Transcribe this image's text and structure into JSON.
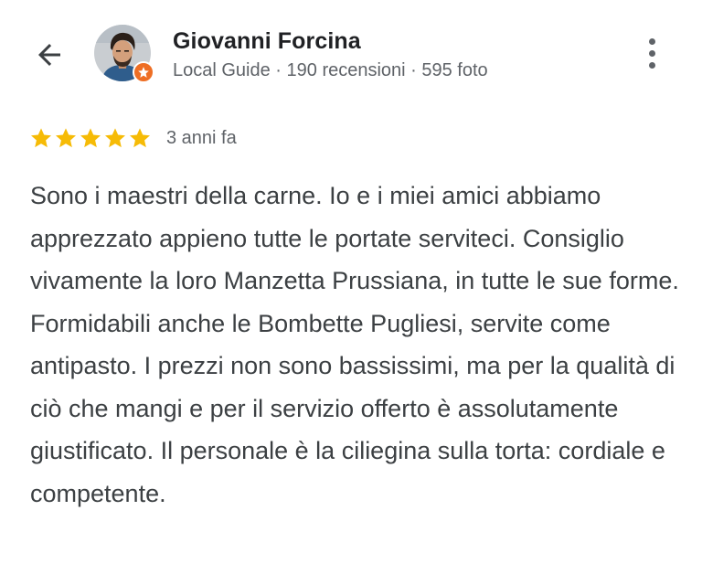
{
  "header": {
    "back_icon": "arrow-back-icon",
    "user_name": "Giovanni Forcina",
    "user_meta": "Local Guide · 190 recensioni · 595 foto",
    "badge_icon": "local-guide-star-icon",
    "menu_icon": "more-vert-icon"
  },
  "review": {
    "rating": 5,
    "rating_max": 5,
    "star_color": "#f6bb06",
    "date": "3 anni fa",
    "text": "Sono i maestri della carne. Io e i miei amici abbiamo apprezzato appieno tutte le portate serviteci. Consiglio vivamente la loro Manzetta Prussiana, in tutte le sue forme. Formidabili anche le Bombette Pugliesi, servite come antipasto. I prezzi non sono bassissimi, ma per la qualità di ciò che mangi e per il servizio offerto è assolutamente giustificato. Il personale è la ciliegina sulla torta: cordiale e competente."
  },
  "colors": {
    "badge": "#ee6e24",
    "secondary_text": "#5f6368",
    "body_text": "#3c4043"
  }
}
